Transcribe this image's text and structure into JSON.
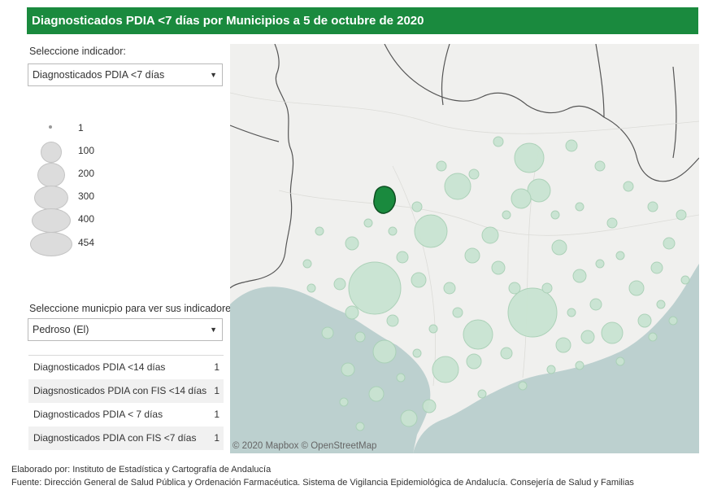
{
  "title": "Diagnosticados PDIA <7 días por Municipios a 5 de octubre de 2020",
  "indicator_label": "Seleccione indicador:",
  "indicator_value": "Diagnosticados PDIA <7 días",
  "legend": [
    "1",
    "100",
    "200",
    "300",
    "400",
    "454"
  ],
  "municipio_label": "Seleccione municpio para ver sus indicadores:",
  "municipio_value": "Pedroso (El)",
  "indicators": [
    {
      "label": "Diagnosticados PDIA <14 días",
      "value": "1"
    },
    {
      "label": "Diagsnosticados PDIA con FIS <14 días",
      "value": "1"
    },
    {
      "label": "Diagnosticados PDIA < 7 días",
      "value": "1"
    },
    {
      "label": "Diagnosticados PDIA con FIS <7 días",
      "value": "1"
    }
  ],
  "map_attribution": "© 2020 Mapbox © OpenStreetMap",
  "footer": {
    "elaborado": "Elaborado por: Instituto de Estadística y Cartografía de Andalucía",
    "fuente": "Fuente: Dirección General de Salud Pública y Ordenación Farmacéutica. Sistema de Vigilancia Epidemiológica de Andalucía. Consejería de Salud y Familias"
  },
  "colors": {
    "header": "#1a8a3e",
    "bubble": "#c9e4d2",
    "bubble_stroke": "#a9d0b6",
    "selected": "#1a8a3e",
    "sea": "#bcd0cf",
    "land": "#f0f0ee"
  },
  "map": {
    "selected_municipio": "Pedroso (El)",
    "bubble_size_legend_max": 454,
    "sea_areas": [
      "Atlantic Ocean",
      "Mediterranean Sea"
    ]
  }
}
